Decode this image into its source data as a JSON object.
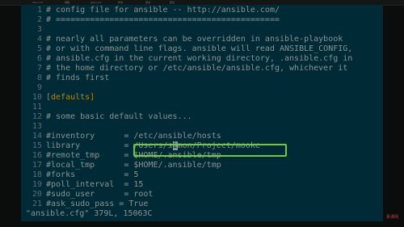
{
  "tabs": [
    "site.conf",
    "课程",
    "site.conf",
    "修改",
    "测试",
    "配置"
  ],
  "lines": [
    {
      "n": "1",
      "t": "# config file for ansible -- http://ansible.com/",
      "k": "txt"
    },
    {
      "n": "2",
      "t": "# ==============================================",
      "k": "txt"
    },
    {
      "n": "3",
      "t": "",
      "k": "txt"
    },
    {
      "n": "4",
      "t": "# nearly all parameters can be overridden in ansible-playbook",
      "k": "txt"
    },
    {
      "n": "5",
      "t": "# or with command line flags. ansible will read ANSIBLE_CONFIG,",
      "k": "txt"
    },
    {
      "n": "6",
      "t": "# ansible.cfg in the current working directory, .ansible.cfg in",
      "k": "txt"
    },
    {
      "n": "7",
      "t": "# the home directory or /etc/ansible/ansible.cfg, whichever it",
      "k": "txt"
    },
    {
      "n": "8",
      "t": "# finds first",
      "k": "txt"
    },
    {
      "n": "9",
      "t": "",
      "k": "txt"
    },
    {
      "n": "10",
      "t": "[defaults]",
      "k": "sec"
    },
    {
      "n": "11",
      "t": "",
      "k": "txt"
    },
    {
      "n": "12",
      "t": "# some basic default values...",
      "k": "txt"
    },
    {
      "n": "13",
      "t": "",
      "k": "txt"
    },
    {
      "n": "14",
      "t": "#inventory      = /etc/ansible/hosts",
      "k": "txt"
    },
    {
      "n": "15",
      "t": "library         = /Users/simon/Project/mooke",
      "k": "txt"
    },
    {
      "n": "16",
      "t": "#remote_tmp     = $HOME/.ansible/tmp",
      "k": "txt"
    },
    {
      "n": "17",
      "t": "#local_tmp      = $HOME/.ansible/tmp",
      "k": "txt"
    },
    {
      "n": "18",
      "t": "#forks          = 5",
      "k": "txt"
    },
    {
      "n": "19",
      "t": "#poll_interval  = 15",
      "k": "txt"
    },
    {
      "n": "20",
      "t": "#sudo_user      = root",
      "k": "txt"
    },
    {
      "n": "21",
      "t": "#ask_sudo_pass = True",
      "k": "txt"
    }
  ],
  "status_line": "\"ansible.cfg\" 379L, 15063C",
  "watermark": "慕课网",
  "colors": {
    "background": "#002b36",
    "text": "#839496",
    "line_number": "#586e75",
    "section": "#b58900",
    "highlight_box": "#73c93c"
  }
}
